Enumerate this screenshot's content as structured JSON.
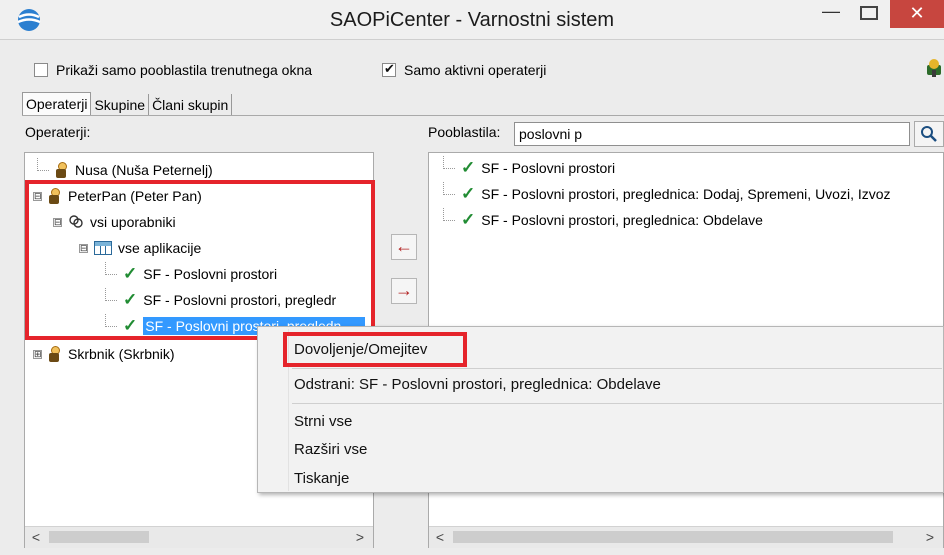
{
  "window": {
    "title": "SAOPiCenter - Varnostni sistem",
    "minimize": "—",
    "close": "✕"
  },
  "options": {
    "only_current_window": {
      "label": "Prikaži samo pooblastila trenutnega okna",
      "checked": false
    },
    "active_operators": {
      "label": "Samo aktivni operaterji",
      "checked": true
    }
  },
  "tabs": [
    {
      "label": "Operaterji",
      "active": true
    },
    {
      "label": "Skupine",
      "active": false
    },
    {
      "label": "Člani skupin",
      "active": false
    }
  ],
  "left_panel": {
    "label": "Operaterji:",
    "tree": [
      {
        "label": "Nusa (Nuša Peternelj)",
        "icon": "person-icon"
      },
      {
        "label": "PeterPan (Peter Pan)",
        "icon": "person-icon",
        "toggle": "⊟"
      },
      {
        "label": "vsi uporabniki",
        "icon": "group-icon",
        "toggle": "⊟"
      },
      {
        "label": "vse aplikacije",
        "icon": "grid-icon",
        "toggle": "⊟"
      },
      {
        "label": "SF - Poslovni prostori",
        "icon": "check-icon"
      },
      {
        "label": "SF - Poslovni prostori, pregledr",
        "icon": "check-icon"
      },
      {
        "label": "SF - Poslovni prostori, pregledn",
        "icon": "check-icon",
        "selected": true
      },
      {
        "label": "Skrbnik (Skrbnik)",
        "icon": "person-icon",
        "toggle": "⊞"
      }
    ],
    "scroll_left": "<",
    "scroll_right": ">"
  },
  "transfer": {
    "add": "←",
    "remove": "→"
  },
  "right_panel": {
    "label": "Pooblastila:",
    "search_value": "poslovni p",
    "search_icon": "magnifier-icon",
    "items": [
      "SF - Poslovni prostori",
      "SF - Poslovni prostori, preglednica: Dodaj, Spremeni, Uvozi, Izvoz",
      "SF - Poslovni prostori, preglednica: Obdelave"
    ],
    "scroll_left": "<",
    "scroll_right": ">"
  },
  "context_menu": {
    "items": [
      "Dovoljenje/Omejitev",
      "Odstrani: SF - Poslovni prostori, preglednica: Obdelave",
      "Strni vse",
      "Razširi vse",
      "Tiskanje"
    ]
  },
  "colors": {
    "highlight": "#e5242b",
    "selection": "#3399ff",
    "check": "#218c33",
    "close_button": "#c7463f"
  }
}
